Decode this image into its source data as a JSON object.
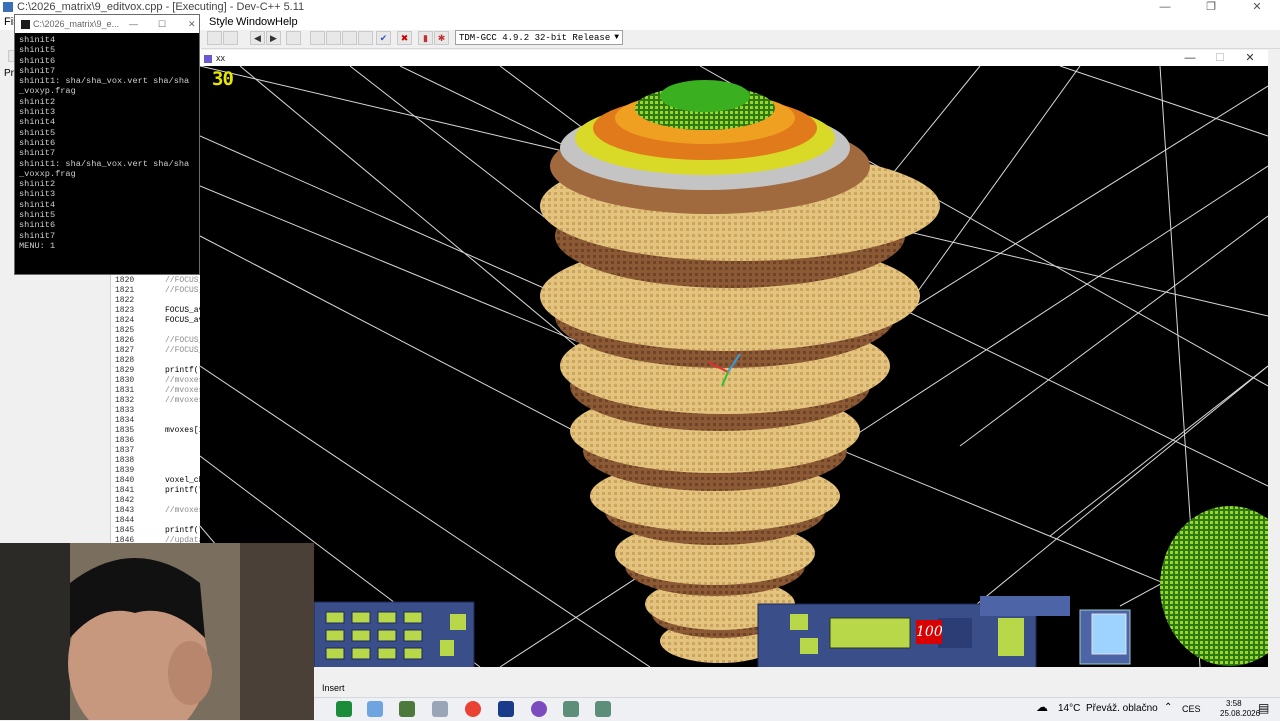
{
  "ide": {
    "title": "C:\\2026_matrix\\9_editvox.cpp - [Executing] - Dev-C++ 5.11",
    "menus": [
      "File",
      "Style",
      "Window",
      "Help"
    ],
    "compiler": "TDM-GCC 4.9.2 32-bit Release",
    "project_tab": "Pro",
    "editor": {
      "line_numbers": [
        "1820",
        "1821",
        "1822",
        "1823",
        "1824",
        "1825",
        "1826",
        "1827",
        "1828",
        "1829",
        "1830",
        "1831",
        "1832",
        "1833",
        "1834",
        "1835",
        "1836",
        "1837",
        "1838",
        "1839",
        "1840",
        "1841",
        "1842",
        "1843",
        "1844",
        "1845",
        "1846"
      ],
      "code_lines": [
        {
          "line": "1820",
          "text": "//FOCUS_",
          "comment": true
        },
        {
          "line": "1821",
          "text": "//FOCUS_",
          "comment": true
        },
        {
          "line": "1823",
          "text": "FOCUS_av",
          "comment": false
        },
        {
          "line": "1824",
          "text": "FOCUS_av",
          "comment": false
        },
        {
          "line": "1826",
          "text": "//FOCUS_",
          "comment": true
        },
        {
          "line": "1827",
          "text": "//FOCUS_",
          "comment": true
        },
        {
          "line": "1829",
          "text": "printf(\"",
          "comment": false
        },
        {
          "line": "1830",
          "text": "//mvoxes",
          "comment": true
        },
        {
          "line": "1831",
          "text": "//mvoxes",
          "comment": true
        },
        {
          "line": "1832",
          "text": "//mvoxes",
          "comment": true
        },
        {
          "line": "1835",
          "text": "mvoxes[i",
          "comment": false
        },
        {
          "line": "1840",
          "text": "voxel_ch",
          "comment": false
        },
        {
          "line": "1841",
          "text": "printf(\"",
          "comment": false
        },
        {
          "line": "1843",
          "text": "//mvoxes",
          "comment": true
        },
        {
          "line": "1845",
          "text": "printf(\"",
          "comment": false
        },
        {
          "line": "1846",
          "text": "//updata",
          "comment": true
        }
      ]
    },
    "status_mode": "Insert"
  },
  "console": {
    "title": "C:\\2026_matrix\\9_e...",
    "lines": [
      "shinit4",
      "shinit5",
      "shinit6",
      "shinit7",
      "shinit1: sha/sha_vox.vert sha/sha",
      "_voxyp.frag",
      "shinit2",
      "shinit3",
      "shinit4",
      "shinit5",
      "shinit6",
      "shinit7",
      "shinit1: sha/sha_vox.vert sha/sha",
      "_voxxp.frag",
      "shinit2",
      "shinit3",
      "shinit4",
      "shinit5",
      "shinit6",
      "shinit7",
      "MENU: 1"
    ]
  },
  "gl_window": {
    "title": "xx",
    "fps": "30",
    "hud_value": "100"
  },
  "taskbar": {
    "weather_temp": "14°C",
    "weather_desc": "Převáž. oblačno",
    "language": "CES",
    "time": "3:58",
    "date": "25.08.2026"
  },
  "colors": {
    "hud_panel": "#3a4e8a",
    "hud_button": "#b8d84a",
    "grid_line": "#d8d8d8",
    "sand": "#e3c37e",
    "health": "#d80000"
  }
}
